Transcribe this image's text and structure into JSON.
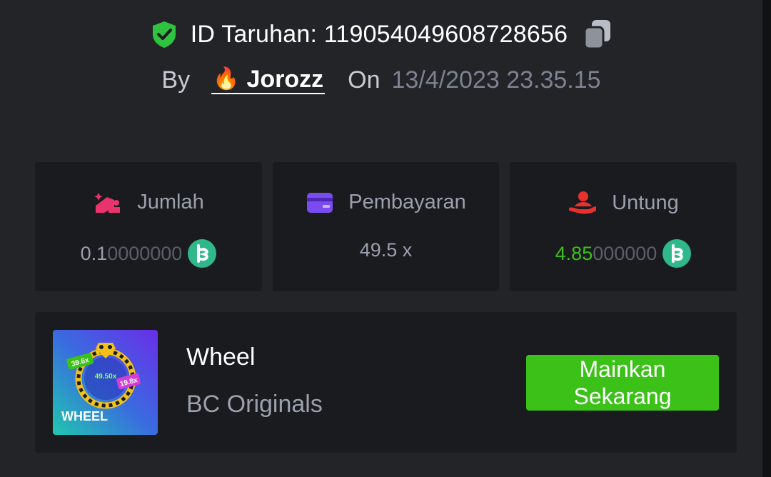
{
  "header": {
    "bet_id_text": "ID Taruhan: 119054049608728656",
    "by_label": "By",
    "username": "Jorozz",
    "on_label": "On",
    "datetime": "13/4/2023 23.35.15"
  },
  "stats": {
    "amount": {
      "label": "Jumlah",
      "value_main": "0.1",
      "value_dim": "0000000",
      "icon": "bet-amount-icon",
      "currency_icon": "bc-coin-icon"
    },
    "payout": {
      "label": "Pembayaran",
      "value": "49.5 x",
      "icon": "card-icon"
    },
    "profit": {
      "label": "Untung",
      "value_main": "4.85",
      "value_dim": "000000",
      "icon": "profit-hand-icon",
      "currency_icon": "bc-coin-icon"
    }
  },
  "game": {
    "name": "Wheel",
    "provider": "BC Originals",
    "play_label": "Mainkan\nSekarang",
    "thumbnail": {
      "title": "WHEEL",
      "labels": [
        "39.6x",
        "49.50x",
        "19.8x"
      ]
    }
  },
  "colors": {
    "background": "#232428",
    "card": "#1a1b1e",
    "accent_green": "#3bc117",
    "muted_text": "#9aa0ad",
    "amount_icon": "#e8336d",
    "payout_icon": "#7a4cf0",
    "profit_icon": "#e8302f",
    "coin": "#2fb98a"
  }
}
